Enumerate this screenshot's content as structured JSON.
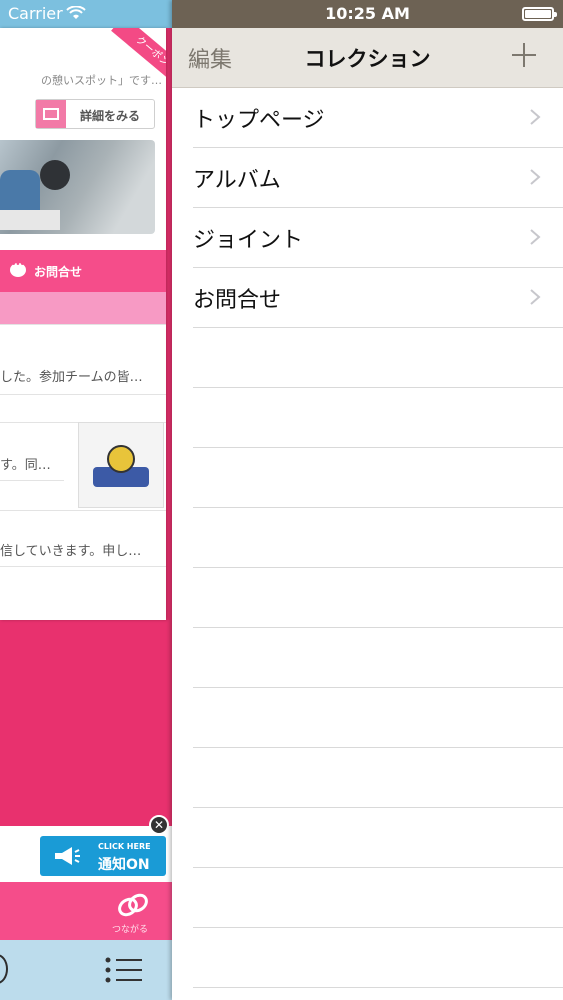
{
  "left_panel": {
    "status": {
      "carrier": "Carrier"
    },
    "coupon_label": "クーポン",
    "intro_text": "の憩いスポット」です…",
    "detail_button": "詳細をみる",
    "contact_label": "お問合せ",
    "news": [
      "した。参加チームの皆…",
      "す。同…",
      "信していきます。申し…"
    ],
    "notify": {
      "click_here": "CLICK HERE",
      "label": "通知ON"
    },
    "footer_label": "つながる"
  },
  "status_bar": {
    "time": "10:25 AM"
  },
  "nav": {
    "edit": "編集",
    "title": "コレクション"
  },
  "collection": [
    {
      "label": "トップページ"
    },
    {
      "label": "アルバム"
    },
    {
      "label": "ジョイント"
    },
    {
      "label": "お問合せ"
    }
  ],
  "colors": {
    "nav_bg": "#e8e5df",
    "status_bg": "#6d6254",
    "pink_accent": "#f54d8a",
    "left_status_bg": "#7cc0df"
  }
}
